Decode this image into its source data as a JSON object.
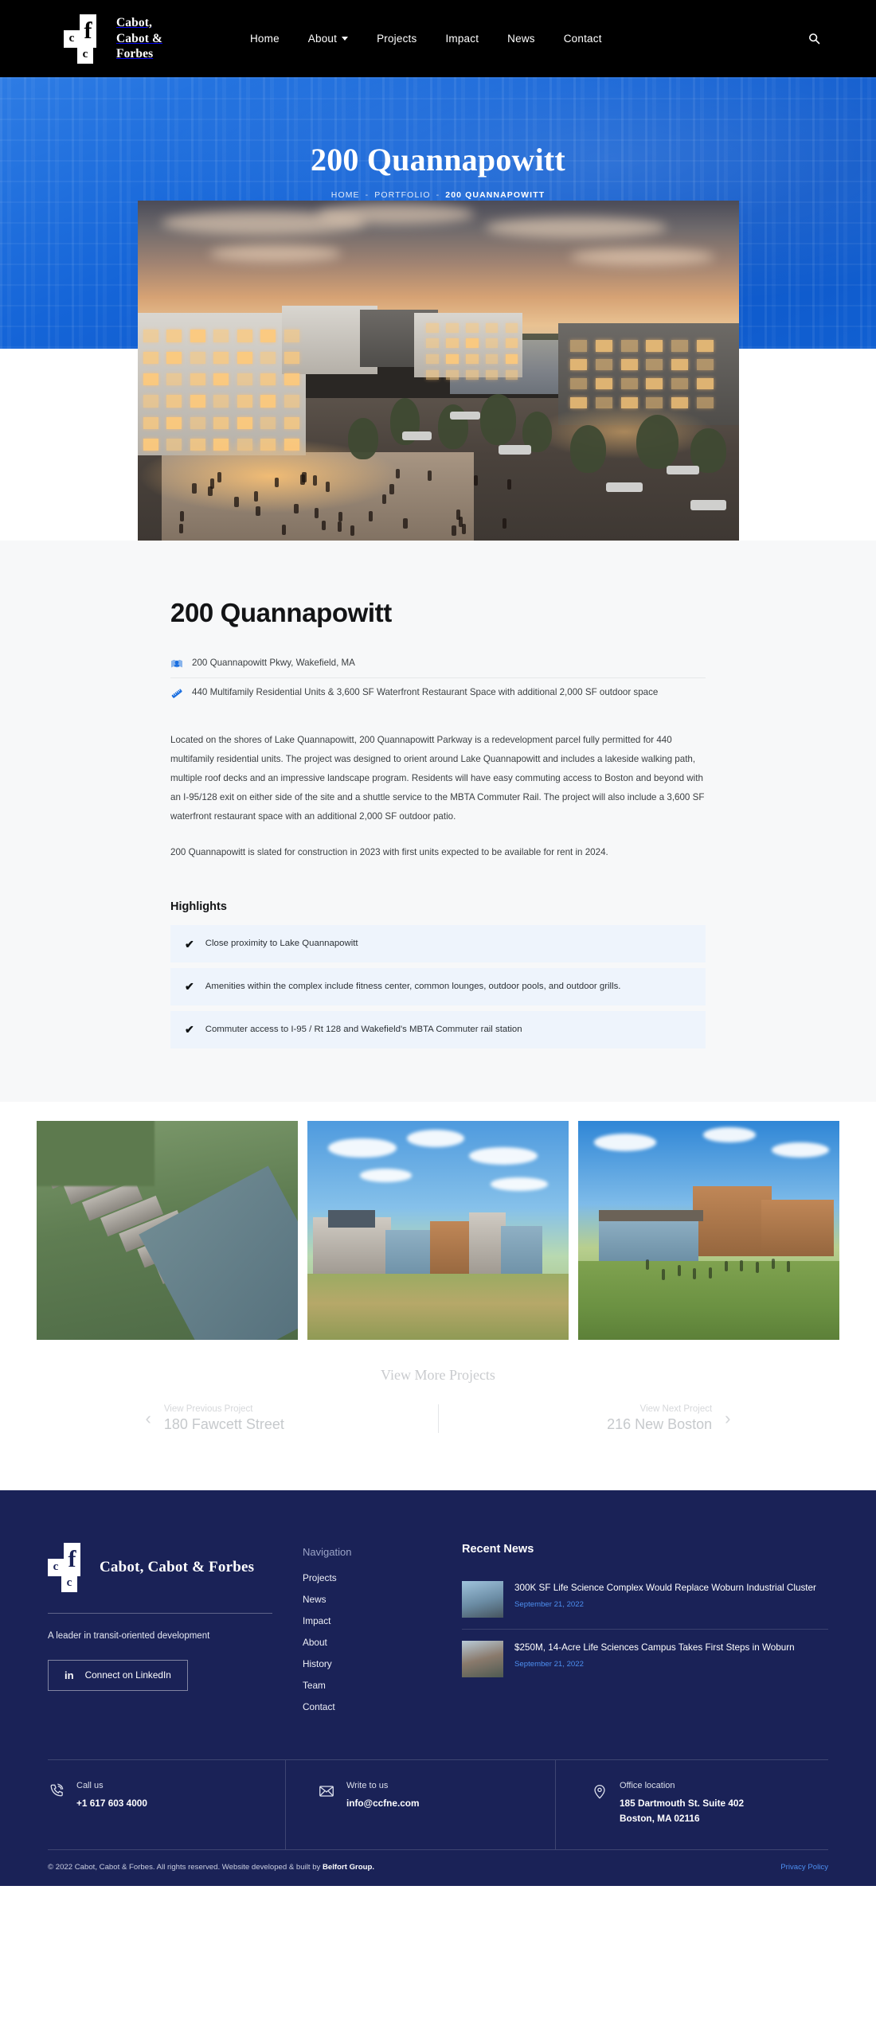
{
  "header": {
    "brand_line1": "Cabot,",
    "brand_line2": "Cabot &",
    "brand_line3": "Forbes",
    "logo_letters": {
      "c1": "c",
      "c2": "c",
      "f": "f"
    },
    "nav": [
      {
        "label": "Home",
        "has_dropdown": false
      },
      {
        "label": "About",
        "has_dropdown": true
      },
      {
        "label": "Projects",
        "has_dropdown": false
      },
      {
        "label": "Impact",
        "has_dropdown": false
      },
      {
        "label": "News",
        "has_dropdown": false
      },
      {
        "label": "Contact",
        "has_dropdown": false
      }
    ],
    "search_icon": "search-icon"
  },
  "hero": {
    "title": "200 Quannapowitt",
    "breadcrumb": {
      "home": "HOME",
      "sep1": "-",
      "portfolio": "PORTFOLIO",
      "sep2": "-",
      "current": "200 QUANNAPOWITT"
    },
    "overlay_color": "#1565d8"
  },
  "project": {
    "title": "200 Quannapowitt",
    "meta": [
      {
        "icon": "location-pin-icon",
        "text": "200 Quannapowitt Pkwy, Wakefield, MA"
      },
      {
        "icon": "ruler-icon",
        "text": "440 Multifamily Residential Units & 3,600 SF Waterfront Restaurant Space with additional 2,000 SF outdoor space"
      }
    ],
    "paragraphs": [
      "Located on the shores of Lake Quannapowitt, 200 Quannapowitt Parkway is a redevelopment parcel fully permitted for 440 multifamily residential units. The project was designed to orient around Lake Quannapowitt and includes a lakeside walking path, multiple roof decks and an impressive landscape program. Residents will have easy commuting access to Boston and beyond with an I-95/128 exit on either side of the site and a shuttle service to the MBTA Commuter Rail. The project will also include a 3,600 SF waterfront restaurant space with an additional 2,000 SF outdoor patio.",
      "200 Quannapowitt is slated for construction in 2023 with first units expected to be available for rent in 2024."
    ],
    "highlights_heading": "Highlights",
    "highlights": [
      "Close proximity to Lake Quannapowitt",
      "Amenities within the complex include fitness center, common lounges, outdoor pools, and outdoor grills.",
      "Commuter access to I-95 / Rt 128 and Wakefield's MBTA Commuter rail station"
    ],
    "check_glyph": "✔"
  },
  "gallery": {
    "items": [
      {
        "alt": "Aerial view of residential complex beside lake"
      },
      {
        "alt": "Street level view of mixed-use buildings with meadow"
      },
      {
        "alt": "Lawn and residential building with people walking"
      }
    ]
  },
  "more": {
    "label": "View More Projects"
  },
  "pager": {
    "prev_label": "View Previous Project",
    "prev_title": "180 Fawcett Street",
    "prev_arrow": "‹",
    "next_label": "View Next Project",
    "next_title": "216 New Boston",
    "next_arrow": "›"
  },
  "footer": {
    "brand": "Cabot, Cabot & Forbes",
    "logo_letters": {
      "c1": "c",
      "c2": "c",
      "f": "f"
    },
    "tagline": "A leader in transit-oriented development",
    "linkedin": {
      "icon": "linkedin-icon",
      "icon_text": "in",
      "label": "Connect on LinkedIn"
    },
    "nav_heading": "Navigation",
    "nav": [
      "Projects",
      "News",
      "Impact",
      "About",
      "History",
      "Team",
      "Contact"
    ],
    "news_heading": "Recent News",
    "news": [
      {
        "title": "300K SF Life Science Complex Would Replace Woburn Industrial Cluster",
        "date": "September 21, 2022"
      },
      {
        "title": "$250M, 14-Acre Life Sciences Campus Takes First Steps in Woburn",
        "date": "September 21, 2022"
      }
    ],
    "contact": [
      {
        "icon": "phone-icon",
        "label": "Call us",
        "value": "+1 617 603 4000"
      },
      {
        "icon": "envelope-icon",
        "label": "Write to us",
        "value": "info@ccfne.com"
      },
      {
        "icon": "map-pin-icon",
        "label": "Office location",
        "value": "185 Dartmouth St. Suite 402\nBoston, MA 02116"
      }
    ],
    "copyright_pre": "© 2022 Cabot, Cabot & Forbes. All rights reserved. Website developed & built by ",
    "copyright_brand": "Belfort Group.",
    "privacy": "Privacy Policy",
    "bg_color": "#1a2257",
    "link_color": "#4d8ff0"
  }
}
